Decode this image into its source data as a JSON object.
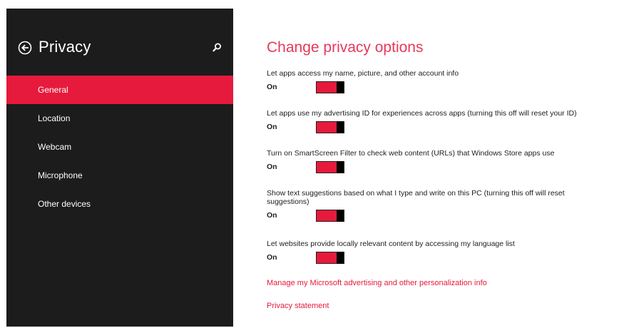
{
  "sidebar": {
    "title": "Privacy",
    "back_icon": "back-arrow-circle-icon",
    "search_icon": "search-icon",
    "items": [
      {
        "label": "General",
        "active": true
      },
      {
        "label": "Location",
        "active": false
      },
      {
        "label": "Webcam",
        "active": false
      },
      {
        "label": "Microphone",
        "active": false
      },
      {
        "label": "Other devices",
        "active": false
      }
    ]
  },
  "main": {
    "title": "Change privacy options",
    "settings": [
      {
        "label": "Let apps access my name, picture, and other account info",
        "state": "On"
      },
      {
        "label": "Let apps use my advertising ID for experiences across apps (turning this off will reset your ID)",
        "state": "On"
      },
      {
        "label": "Turn on SmartScreen Filter to check web content (URLs) that Windows Store apps use",
        "state": "On"
      },
      {
        "label": "Show text suggestions based on what I type and write on this PC (turning this off will reset suggestions)",
        "state": "On"
      },
      {
        "label": "Let websites provide locally relevant content by accessing my language list",
        "state": "On"
      }
    ],
    "links": [
      "Manage my Microsoft advertising and other personalization info",
      "Privacy statement"
    ]
  },
  "colors": {
    "accent": "#e61a3c",
    "title_accent": "#e8385b",
    "sidebar_bg": "#1c1c1c"
  }
}
